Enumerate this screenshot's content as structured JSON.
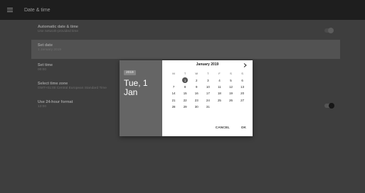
{
  "app_bar": {
    "title": "Date & time",
    "menu_icon": "hamburger-menu-icon"
  },
  "settings": [
    {
      "title": "Automatic date & time",
      "subtitle": "Use network-provided time"
    },
    {
      "title": "Set date",
      "subtitle": "1 January 2019"
    },
    {
      "title": "Set time",
      "subtitle": "00:00"
    },
    {
      "title": "Select time zone",
      "subtitle": "GMT+01:00 Central European Standard Time"
    },
    {
      "title": "Use 24-hour format",
      "subtitle": "13:00"
    }
  ],
  "toggles": {
    "automatic": false,
    "use_24_hour": true
  },
  "dialog": {
    "year": "2019",
    "date_line1": "Tue, 1",
    "date_line2": "Jan",
    "month_label": "January 2019",
    "weekdays": [
      "M",
      "T",
      "W",
      "T",
      "F",
      "S",
      "S"
    ],
    "weeks": [
      [
        "",
        "1",
        "2",
        "3",
        "4",
        "5",
        "6"
      ],
      [
        "7",
        "8",
        "9",
        "10",
        "11",
        "12",
        "13"
      ],
      [
        "14",
        "15",
        "16",
        "17",
        "18",
        "19",
        "20"
      ],
      [
        "21",
        "22",
        "23",
        "24",
        "25",
        "26",
        "27"
      ],
      [
        "28",
        "29",
        "30",
        "31",
        "",
        "",
        ""
      ]
    ],
    "selected_day": "1",
    "cancel_label": "CANCEL",
    "ok_label": "OK"
  },
  "colors": {
    "background": "#3e3e3e",
    "app_bar": "#1e1e1e",
    "dialog_header": "#656565",
    "selected_day": "#555555"
  }
}
